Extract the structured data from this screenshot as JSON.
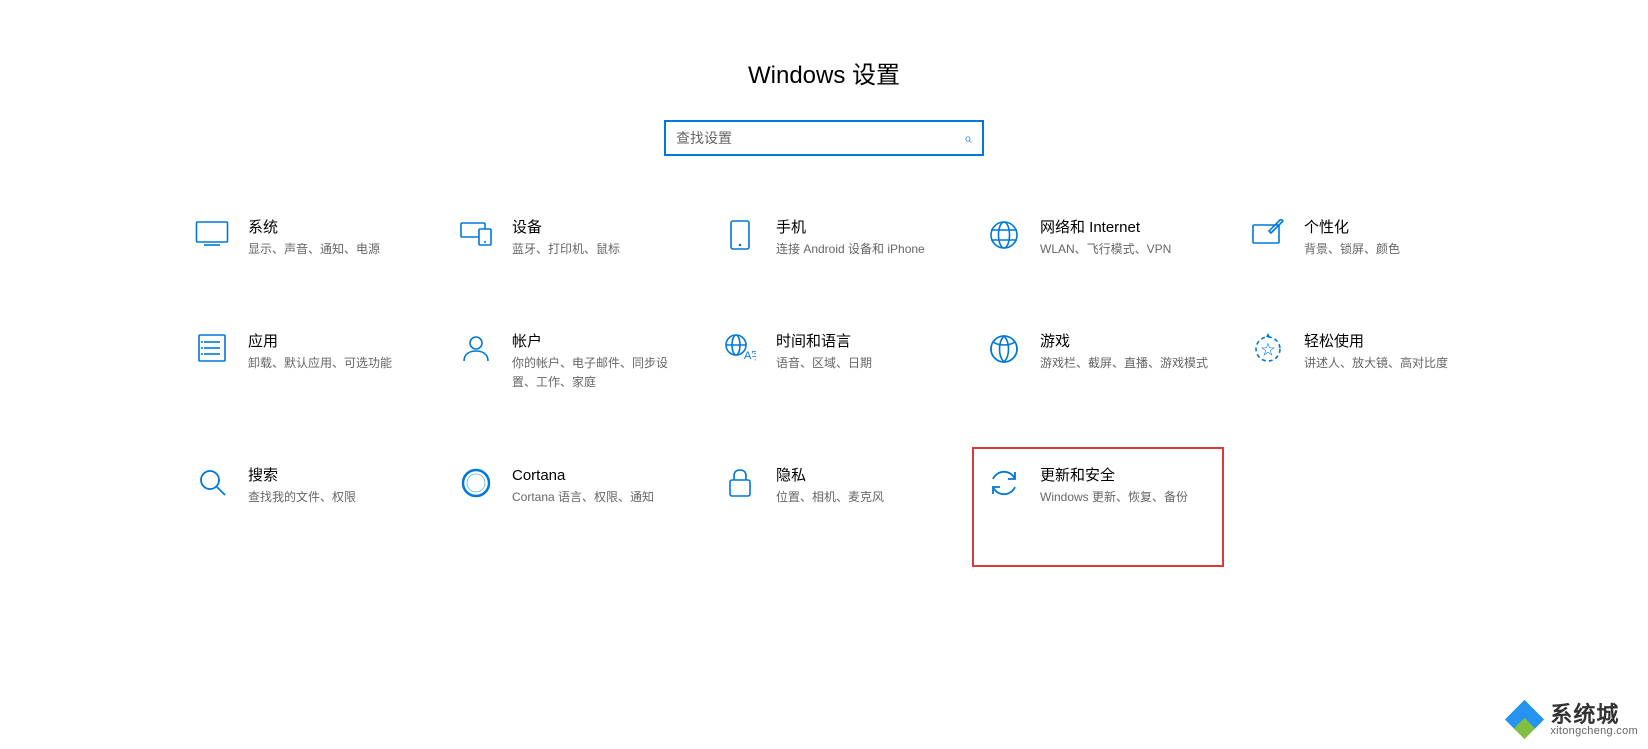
{
  "page_title": "Windows 设置",
  "search": {
    "placeholder": "查找设置"
  },
  "tiles": [
    {
      "id": "system",
      "title": "系统",
      "desc": "显示、声音、通知、电源"
    },
    {
      "id": "devices",
      "title": "设备",
      "desc": "蓝牙、打印机、鼠标"
    },
    {
      "id": "phone",
      "title": "手机",
      "desc": "连接 Android 设备和 iPhone"
    },
    {
      "id": "network",
      "title": "网络和 Internet",
      "desc": "WLAN、飞行模式、VPN"
    },
    {
      "id": "personalize",
      "title": "个性化",
      "desc": "背景、锁屏、颜色"
    },
    {
      "id": "apps",
      "title": "应用",
      "desc": "卸载、默认应用、可选功能"
    },
    {
      "id": "accounts",
      "title": "帐户",
      "desc": "你的帐户、电子邮件、同步设置、工作、家庭"
    },
    {
      "id": "time_language",
      "title": "时间和语言",
      "desc": "语音、区域、日期"
    },
    {
      "id": "gaming",
      "title": "游戏",
      "desc": "游戏栏、截屏、直播、游戏模式"
    },
    {
      "id": "ease",
      "title": "轻松使用",
      "desc": "讲述人、放大镜、高对比度"
    },
    {
      "id": "search",
      "title": "搜索",
      "desc": "查找我的文件、权限"
    },
    {
      "id": "cortana",
      "title": "Cortana",
      "desc": "Cortana 语言、权限、通知"
    },
    {
      "id": "privacy",
      "title": "隐私",
      "desc": "位置、相机、麦克风"
    },
    {
      "id": "update",
      "title": "更新和安全",
      "desc": "Windows 更新、恢复、备份",
      "highlighted": true
    }
  ],
  "watermark": {
    "title": "系统城",
    "sub": "xitongcheng.com"
  },
  "colors": {
    "accent": "#0078d7",
    "highlight_border": "#d83b3b"
  }
}
